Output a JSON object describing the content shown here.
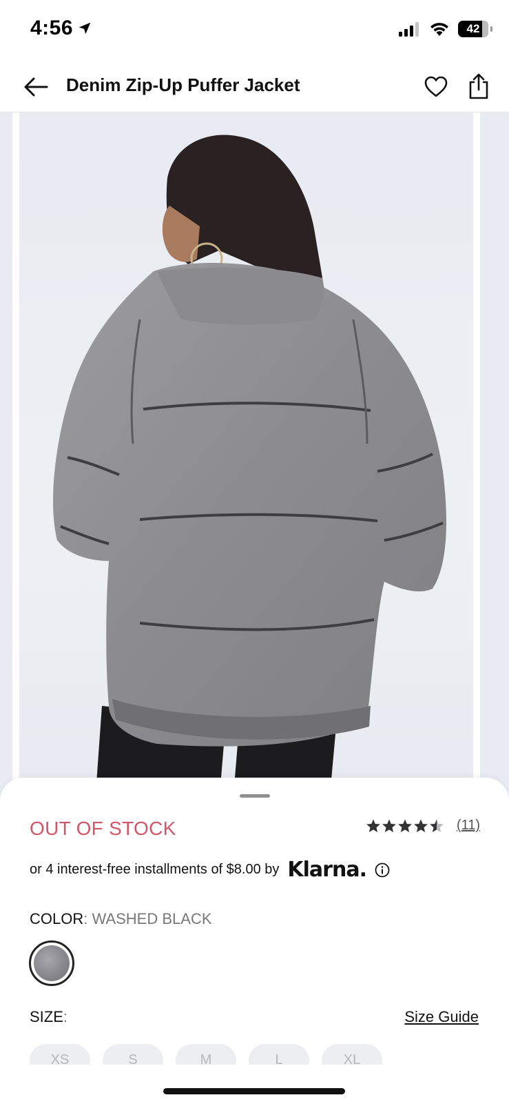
{
  "status_bar": {
    "time": "4:56",
    "battery": "42"
  },
  "header": {
    "title": "Denim Zip-Up Puffer Jacket"
  },
  "product": {
    "stock_status": "OUT OF STOCK",
    "rating": 4.5,
    "review_count": "(11)",
    "installments_text": "or 4 interest-free installments of $8.00 by",
    "klarna_label": "Klarna.",
    "color_label": "COLOR",
    "color_separator": ":",
    "color_value": "WASHED BLACK",
    "size_label": "SIZE",
    "size_separator": ":",
    "size_guide": "Size Guide",
    "sizes": [
      "XS",
      "S",
      "M",
      "L",
      "XL"
    ]
  },
  "colors": {
    "stock_red": "#d15669",
    "jacket_gray": "#8d8d92",
    "background": "#e8ebf1"
  }
}
